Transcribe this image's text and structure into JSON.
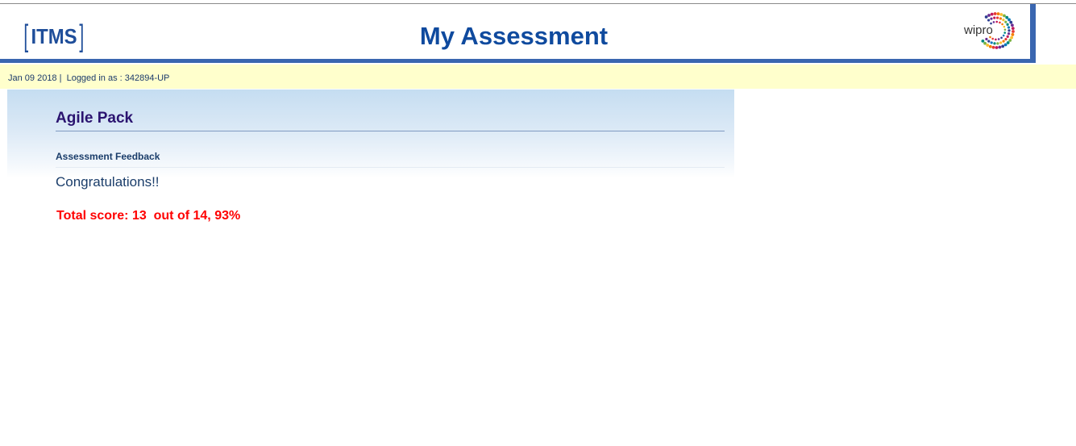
{
  "header": {
    "logo_left_bracket": "[",
    "logo_text": "ITMS",
    "logo_right_bracket": "]",
    "title": "My Assessment",
    "brand_logo_text": "wipro",
    "accent_color": "#3a66b0",
    "title_color": "#0f4a9e"
  },
  "status_bar": {
    "text": "Jan 09 2018 |  Logged in as : 342894-UP",
    "background": "#ffffcc"
  },
  "main": {
    "pack_title": "Agile Pack",
    "section_label": "Assessment Feedback",
    "message": "Congratulations!!",
    "score_text": "Total score: 13  out of 14, 93%",
    "score_color": "#ff0000"
  }
}
